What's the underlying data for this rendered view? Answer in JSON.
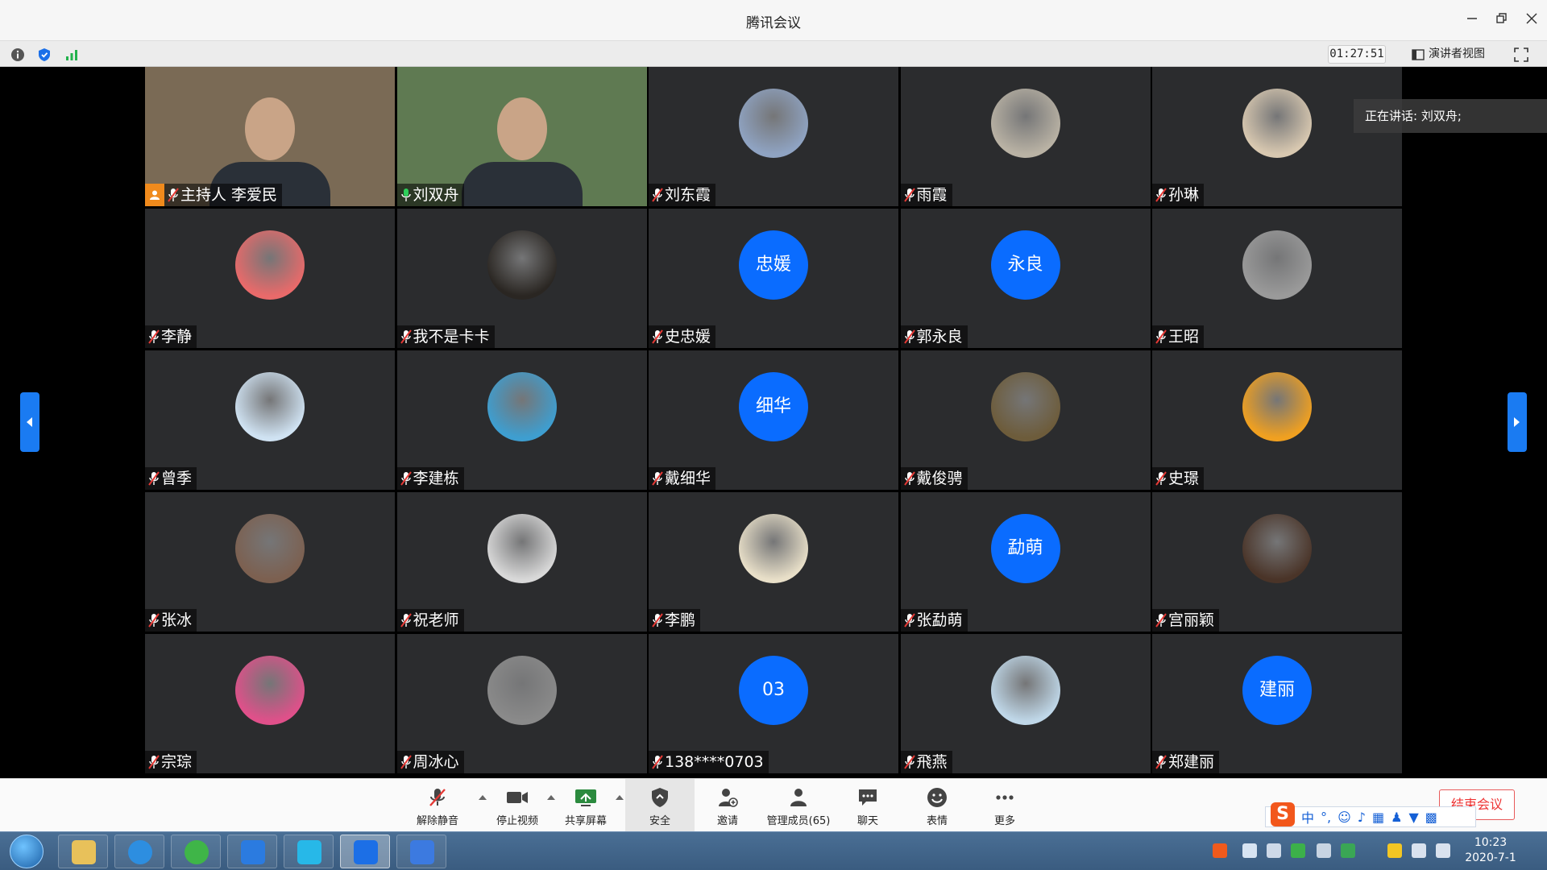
{
  "window": {
    "title": "腾讯会议"
  },
  "infobar": {
    "timer": "01:27:51",
    "view_label": "演讲者视图"
  },
  "speaking": {
    "text": "正在讲话: 刘双舟;"
  },
  "participants": [
    {
      "name": "主持人 李爱民",
      "avatar": "video",
      "bg": "#7a6a55",
      "host": true
    },
    {
      "name": "刘双舟",
      "avatar": "video",
      "bg": "#5f7a52",
      "speaking": true
    },
    {
      "name": "刘东霞",
      "avatar": "photo",
      "bg": "#8fa3c2"
    },
    {
      "name": "雨霞",
      "avatar": "photo",
      "bg": "#b9b2a4"
    },
    {
      "name": "孙琳",
      "avatar": "photo",
      "bg": "#d8c8b0"
    },
    {
      "name": "李静",
      "avatar": "photo",
      "bg": "#e96a6a"
    },
    {
      "name": "我不是卡卡",
      "avatar": "photo",
      "bg": "#2a2622"
    },
    {
      "name": "史忠媛",
      "avatar": "initial",
      "initial": "忠媛"
    },
    {
      "name": "郭永良",
      "avatar": "initial",
      "initial": "永良"
    },
    {
      "name": "王昭",
      "avatar": "photo",
      "bg": "#9a9a9a"
    },
    {
      "name": "曾季",
      "avatar": "photo",
      "bg": "#cfe2f2"
    },
    {
      "name": "李建栋",
      "avatar": "photo",
      "bg": "#3e9ed0"
    },
    {
      "name": "戴细华",
      "avatar": "initial",
      "initial": "细华"
    },
    {
      "name": "戴俊骋",
      "avatar": "photo",
      "bg": "#6d5c3b"
    },
    {
      "name": "史璟",
      "avatar": "photo",
      "bg": "#f0a020"
    },
    {
      "name": "张冰",
      "avatar": "photo",
      "bg": "#7c6050"
    },
    {
      "name": "祝老师",
      "avatar": "photo",
      "bg": "#d8d8d8"
    },
    {
      "name": "李鹏",
      "avatar": "photo",
      "bg": "#e8dfc8"
    },
    {
      "name": "张勐萌",
      "avatar": "initial",
      "initial": "勐萌"
    },
    {
      "name": "宫丽颖",
      "avatar": "photo",
      "bg": "#4a3428"
    },
    {
      "name": "宗琮",
      "avatar": "photo",
      "bg": "#e0508a"
    },
    {
      "name": "周冰心",
      "avatar": "photo",
      "bg": "#8a8a8a"
    },
    {
      "name": "138****0703",
      "avatar": "initial",
      "initial": "03"
    },
    {
      "name": "飛燕",
      "avatar": "photo",
      "bg": "#bfd7e8"
    },
    {
      "name": "郑建丽",
      "avatar": "initial",
      "initial": "建丽"
    }
  ],
  "toolbar": {
    "unmute": "解除静音",
    "stop_video": "停止视频",
    "share_screen": "共享屏幕",
    "security": "安全",
    "invite": "邀请",
    "members": "管理成员(65)",
    "chat": "聊天",
    "reactions": "表情",
    "more": "更多",
    "end_meeting": "结束会议"
  },
  "ime": {
    "logo": "S",
    "mode": "中"
  },
  "taskbar": {
    "time": "10:23",
    "date": "2020-7-1"
  },
  "colors": {
    "accent": "#0a6cff",
    "speaking_border": "#2ecf5a",
    "host_badge": "#f08a1c",
    "end_red": "#e33333"
  }
}
